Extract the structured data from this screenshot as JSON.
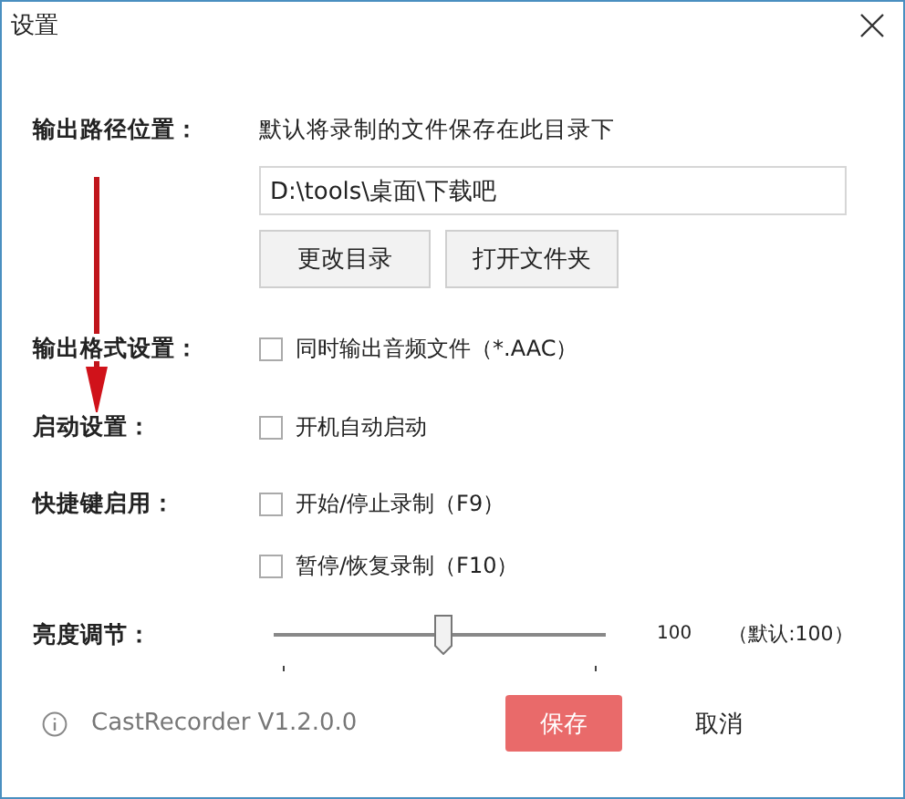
{
  "window": {
    "title": "设置"
  },
  "output_path": {
    "label": "输出路径位置：",
    "hint": "默认将录制的文件保存在此目录下",
    "value": "D:\\tools\\桌面\\下载吧",
    "buttons": [
      "更改目录",
      "打开文件夹"
    ]
  },
  "options": [
    {
      "label": "输出格式设置：",
      "checkboxes": [
        {
          "text": "同时输出音频文件（*.AAC）",
          "checked": false
        }
      ]
    },
    {
      "label": "启动设置：",
      "checkboxes": [
        {
          "text": "开机自动启动",
          "checked": false
        }
      ]
    },
    {
      "label": "快捷键启用：",
      "checkboxes": [
        {
          "text": "开始/停止录制（F9）",
          "checked": false
        },
        {
          "text": "暂停/恢复录制（F10）",
          "checked": false
        }
      ]
    }
  ],
  "brightness": {
    "label": "亮度调节：",
    "level": 0.51,
    "reading": "100",
    "default": "（默认:100）"
  },
  "footer": {
    "version": "CastRecorder V1.2.0.0",
    "save": "保存",
    "cancel": "取消"
  }
}
